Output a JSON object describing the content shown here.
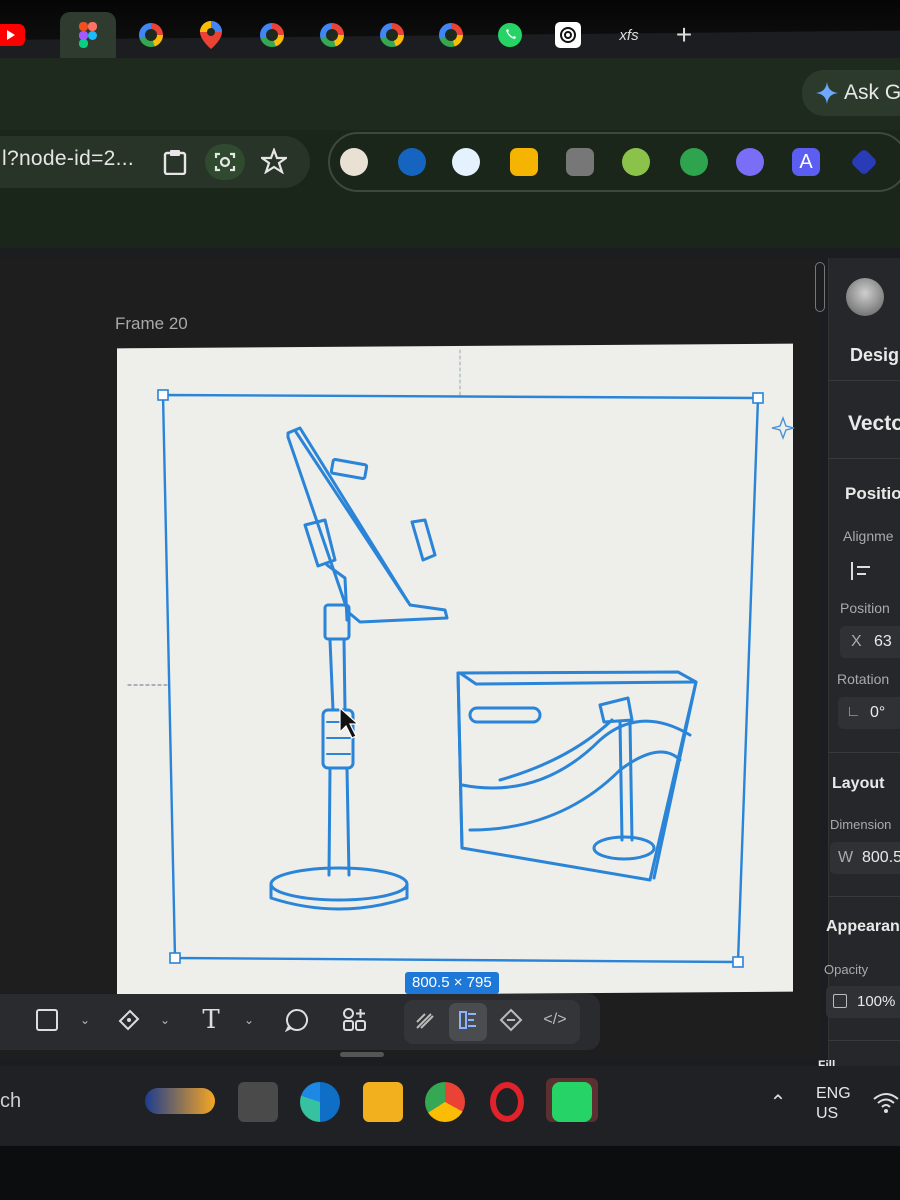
{
  "browser": {
    "tabs": [
      {
        "id": "youtube",
        "icon": "youtube-icon"
      },
      {
        "id": "figma",
        "icon": "figma-icon",
        "active": true
      },
      {
        "id": "google-1",
        "icon": "google-icon"
      },
      {
        "id": "maps",
        "icon": "maps-pin-icon"
      },
      {
        "id": "google-2",
        "icon": "google-icon"
      },
      {
        "id": "google-3",
        "icon": "google-icon"
      },
      {
        "id": "google-4",
        "icon": "google-icon"
      },
      {
        "id": "google-5",
        "icon": "google-icon"
      },
      {
        "id": "whatsapp",
        "icon": "whatsapp-icon"
      },
      {
        "id": "chatgpt",
        "icon": "openai-icon"
      },
      {
        "id": "xfs",
        "label": "xfs"
      }
    ],
    "new_tab_label": "+",
    "ask_label": "Ask G",
    "url_text": "l?node-id=2...",
    "colors": {
      "tabstrip": "#1f2a1f",
      "toolbar": "#1b261b",
      "accent": "#1e78d8"
    }
  },
  "canvas": {
    "frame_name": "Frame 20",
    "selection_size": "800.5 × 795",
    "stroke_color": "#2a84d8"
  },
  "panel": {
    "tab": "Desig",
    "layer_type": "Vecto",
    "position_heading": "Positio",
    "alignment_label": "Alignme",
    "position_label": "Position",
    "x_label": "X",
    "x_value": "63",
    "rotation_label": "Rotation",
    "rotation_value": "0°",
    "layout_heading": "Layout",
    "dimensions_label": "Dimension",
    "w_label": "W",
    "w_value": "800.5",
    "appearance_heading": "Appearan",
    "opacity_label": "Opacity",
    "opacity_value": "100%",
    "fill_heading": "Fill"
  },
  "taskbar": {
    "search_text": "ch",
    "lang_line1": "ENG",
    "lang_line2": "US"
  }
}
